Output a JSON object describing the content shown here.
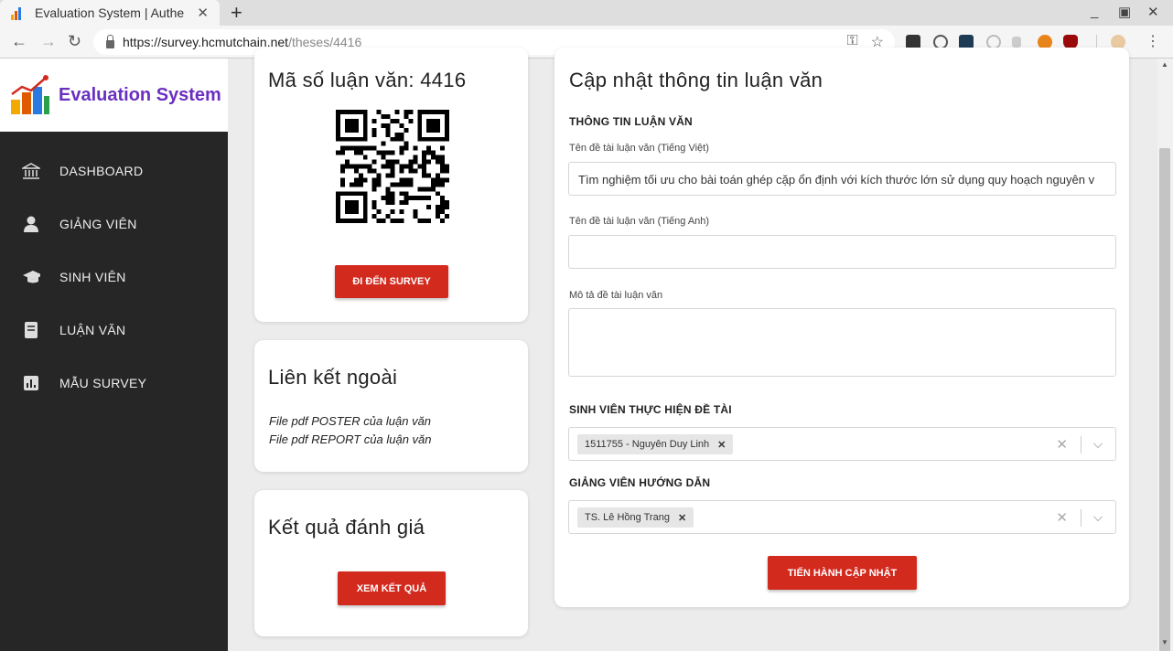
{
  "browser": {
    "tab_title": "Evaluation System | Authe",
    "url_host": "https://survey.hcmutchain.net",
    "url_path": "/theses/4416"
  },
  "sidebar": {
    "brand": "Evaluation System",
    "items": [
      {
        "label": "DASHBOARD",
        "icon": "bank-icon"
      },
      {
        "label": "GIẢNG VIÊN",
        "icon": "person-icon"
      },
      {
        "label": "SINH VIÊN",
        "icon": "graduation-cap-icon"
      },
      {
        "label": "LUẬN VĂN",
        "icon": "book-icon"
      },
      {
        "label": "MẪU SURVEY",
        "icon": "bar-chart-icon"
      }
    ]
  },
  "thesis_card": {
    "title": "Mã số luận văn: 4416",
    "button": "ĐI ĐẾN SURVEY"
  },
  "links_card": {
    "title": "Liên kết ngoài",
    "links": [
      "File pdf POSTER của luận văn",
      "File pdf REPORT của luận văn"
    ]
  },
  "results_card": {
    "title": "Kết quả đánh giá",
    "button": "XEM KẾT QUẢ"
  },
  "form": {
    "title": "Cập nhật thông tin luận văn",
    "section_info": "THÔNG TIN LUẬN VĂN",
    "label_vi": "Tên đề tài luận văn (Tiếng Việt)",
    "value_vi": "Tìm nghiệm tối ưu cho bài toán ghép cặp ổn định với kích thước lớn sử dụng quy hoạch nguyên v",
    "label_en": "Tên đề tài luận văn (Tiếng Anh)",
    "value_en": "",
    "label_desc": "Mô tả đề tài luận văn",
    "value_desc": "",
    "section_students": "SINH VIÊN THỰC HIỆN ĐỀ TÀI",
    "student_chip": "1511755 - Nguyên Duy Linh",
    "section_advisor": "GIẢNG VIÊN HƯỚNG DẪN",
    "advisor_chip": "TS. Lê Hồng Trang",
    "submit": "TIẾN HÀNH CẬP NHẬT"
  },
  "colors": {
    "accent_red": "#d32a1e",
    "brand_purple": "#6a2fbf",
    "sidebar_bg": "#262626"
  }
}
